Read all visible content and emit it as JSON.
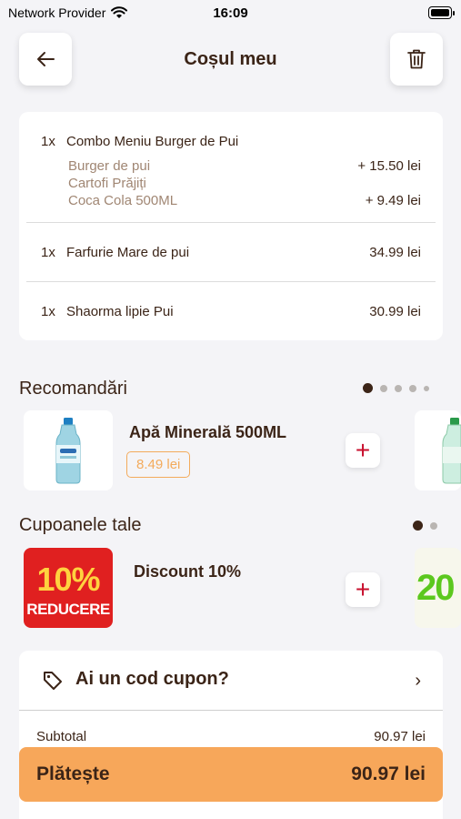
{
  "status": {
    "provider": "Network Provider",
    "time": "16:09"
  },
  "header": {
    "title": "Coșul meu",
    "back_icon": "arrow-left-icon",
    "trash_icon": "trash-icon"
  },
  "cart": {
    "items": [
      {
        "qty": "1x",
        "name": "Combo Meniu Burger de Pui",
        "options": [
          {
            "name": "Burger de pui",
            "price": "+ 15.50 lei"
          },
          {
            "name": "Cartofi Prăjiți",
            "price": ""
          },
          {
            "name": "Coca Cola 500ML",
            "price": "+ 9.49 lei"
          }
        ]
      },
      {
        "qty": "1x",
        "name": "Farfurie Mare de pui",
        "price": "34.99 lei"
      },
      {
        "qty": "1x",
        "name": "Shaorma lipie Pui",
        "price": "30.99 lei"
      }
    ]
  },
  "recommendations": {
    "title": "Recomandări",
    "items": [
      {
        "name": "Apă Minerală 500ML",
        "price": "8.49 lei"
      }
    ],
    "add_symbol": "+"
  },
  "coupons": {
    "title": "Cupoanele tale",
    "items": [
      {
        "name": "Discount 10%",
        "badge_line1": "10%",
        "badge_line2": "REDUCERE",
        "next_badge": "20"
      }
    ],
    "add_symbol": "+"
  },
  "coupon_code": {
    "label": "Ai un cod cupon?",
    "icon": "tag-icon",
    "chevron": "›"
  },
  "summary": {
    "subtotal_label": "Subtotal",
    "subtotal_value": "90.97 lei"
  },
  "pay": {
    "label": "Plătește",
    "total": "90.97 lei"
  },
  "colors": {
    "accent": "#f7a75a",
    "text": "#3b2417",
    "muted": "#a08673",
    "plus": "#c8102e",
    "badge_red": "#e02020",
    "badge_yellow": "#ffd23f"
  }
}
